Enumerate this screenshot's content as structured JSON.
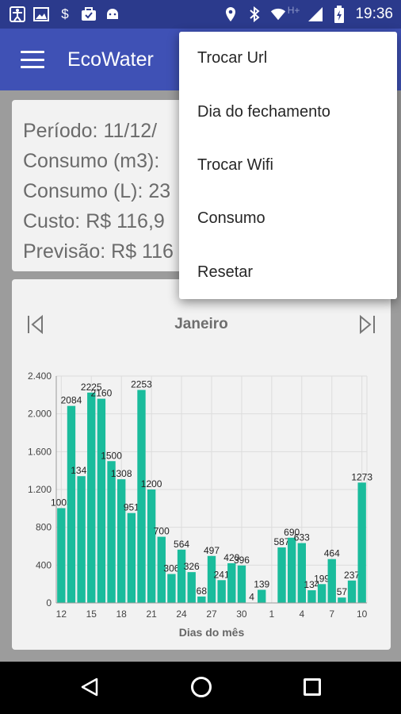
{
  "status_bar": {
    "time": "19:36",
    "network_label": "H+",
    "left_icons": [
      "accessibility-icon",
      "image-icon",
      "dollar-icon",
      "briefcase-icon",
      "android-icon"
    ],
    "right_icons": [
      "location-icon",
      "bluetooth-icon",
      "wifi-icon",
      "signal-icon",
      "battery-icon"
    ]
  },
  "app_bar": {
    "title": "EcoWater"
  },
  "info": {
    "periodo": "Período: 11/12/",
    "consumo_m3": "Consumo (m3):",
    "consumo_l": "Consumo (L): 23",
    "custo": "Custo: R$ 116,9",
    "previsao": "Previsão: R$ 116"
  },
  "chart_nav": {
    "month": "Janeiro"
  },
  "chart_data": {
    "type": "bar",
    "title": "Janeiro",
    "xlabel": "Dias do mês",
    "ylabel": "",
    "ylim": [
      0,
      2400
    ],
    "y_ticks": [
      "0",
      "400",
      "800",
      "1.200",
      "1.600",
      "2.000",
      "2.400"
    ],
    "x_tick_labels": [
      "12",
      "15",
      "18",
      "21",
      "24",
      "27",
      "30",
      "1",
      "4",
      "7",
      "10"
    ],
    "categories": [
      "12",
      "13",
      "14",
      "15",
      "16",
      "17",
      "18",
      "19",
      "20",
      "21",
      "22",
      "23",
      "24",
      "25",
      "26",
      "27",
      "28",
      "29",
      "30",
      "31",
      "1",
      "2",
      "3",
      "4",
      "5",
      "6",
      "7",
      "8",
      "9",
      "10"
    ],
    "values": [
      1003,
      2084,
      1341,
      2225,
      2160,
      1500,
      1308,
      951,
      2253,
      1200,
      700,
      306,
      564,
      326,
      68,
      497,
      241,
      420,
      396,
      4,
      139,
      0,
      587,
      690,
      633,
      134,
      199,
      464,
      57,
      237,
      1273
    ],
    "bar_color": "#1abc9c",
    "grid": true,
    "legend": "none"
  },
  "popup_menu": {
    "items": [
      "Trocar Url",
      "Dia do fechamento",
      "Trocar Wifi",
      "Consumo",
      "Resetar"
    ]
  }
}
